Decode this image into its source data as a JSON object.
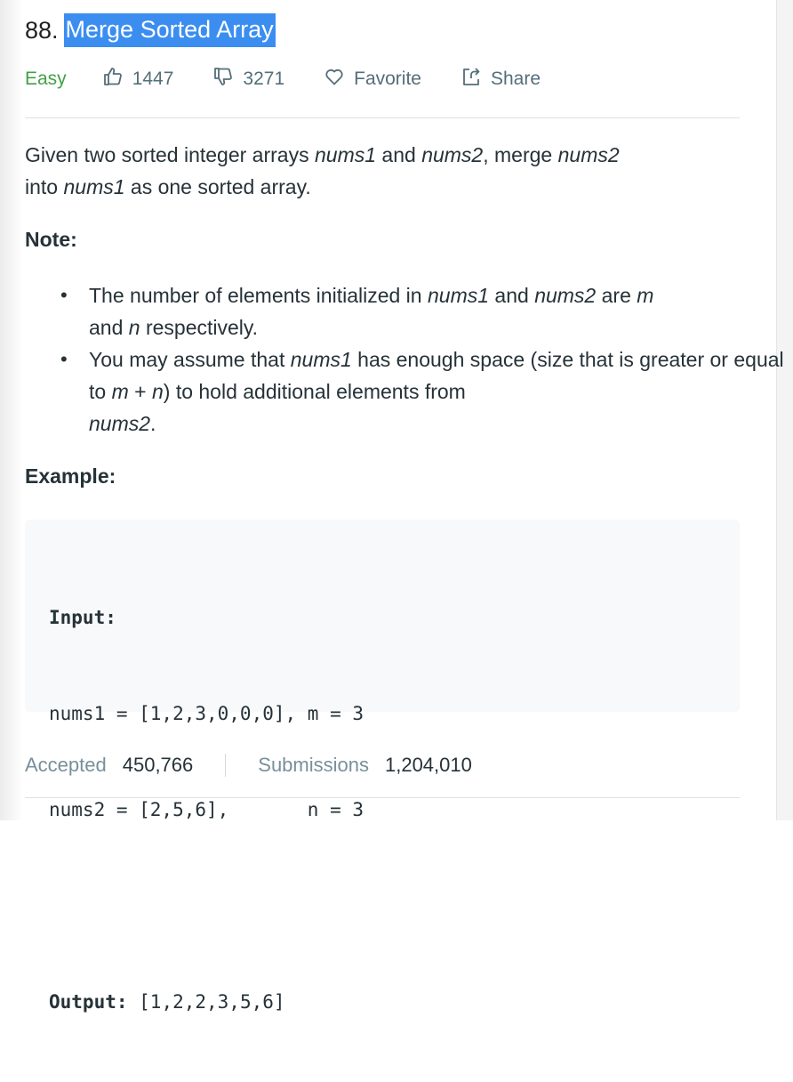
{
  "problem": {
    "number": "88.",
    "title": "Merge Sorted Array"
  },
  "meta": {
    "difficulty": "Easy",
    "likes": "1447",
    "dislikes": "3271",
    "favorite_label": "Favorite",
    "share_label": "Share",
    "icons": [
      "thumbs-up-icon",
      "thumbs-down-icon",
      "heart-icon",
      "share-icon"
    ],
    "colors": {
      "difficulty": "#43a047",
      "selection": "#3b8ef0"
    }
  },
  "description": {
    "intro": [
      "Given two sorted integer arrays ",
      "nums1",
      " and ",
      "nums2",
      ", merge ",
      "nums2",
      " into ",
      "nums1",
      " as one sorted array."
    ]
  },
  "note": {
    "heading": "Note:",
    "item1": [
      "The number of elements initialized in ",
      "nums1",
      " and ",
      "nums2",
      " are ",
      "m",
      " and ",
      "n",
      " respectively."
    ],
    "item2": [
      "You may assume that ",
      "nums1",
      " has enough space (size that is greater or equal to ",
      "m",
      " + ",
      "n",
      ") to hold additional elements from ",
      "nums2",
      "."
    ]
  },
  "example": {
    "heading": "Example:",
    "input_label": "Input:",
    "line1": "nums1 = [1,2,3,0,0,0], m = 3",
    "line2": "nums2 = [2,5,6],       n = 3",
    "output_label": "Output:",
    "output_value": " [1,2,2,3,5,6]"
  },
  "stats": {
    "accepted_label": "Accepted",
    "accepted_value": "450,766",
    "submissions_label": "Submissions",
    "submissions_value": "1,204,010"
  }
}
